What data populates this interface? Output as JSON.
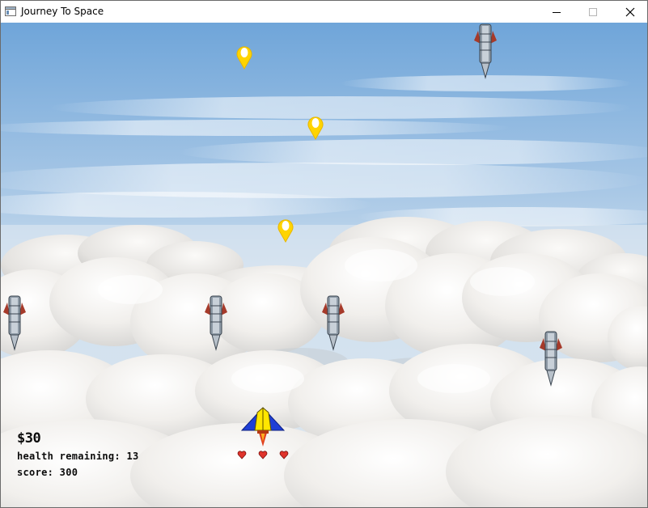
{
  "window": {
    "title": "Journey To Space"
  },
  "hud": {
    "money": "$30",
    "health": "health remaining: 13",
    "score": "score: 300"
  },
  "lives_hearts": 3,
  "colors": {
    "sky_top": "#6fa6d8",
    "sky_bottom": "#cfe2f1",
    "cloud": "#f3f1ee",
    "player_wing": "#1f3fd6",
    "player_body": "#ffe600",
    "heart": "#e0342c",
    "bullet": "#ffd400"
  },
  "icons": {
    "app": "app-window-icon",
    "minimize": "minimize-icon",
    "maximize": "maximize-icon",
    "close": "close-icon"
  }
}
